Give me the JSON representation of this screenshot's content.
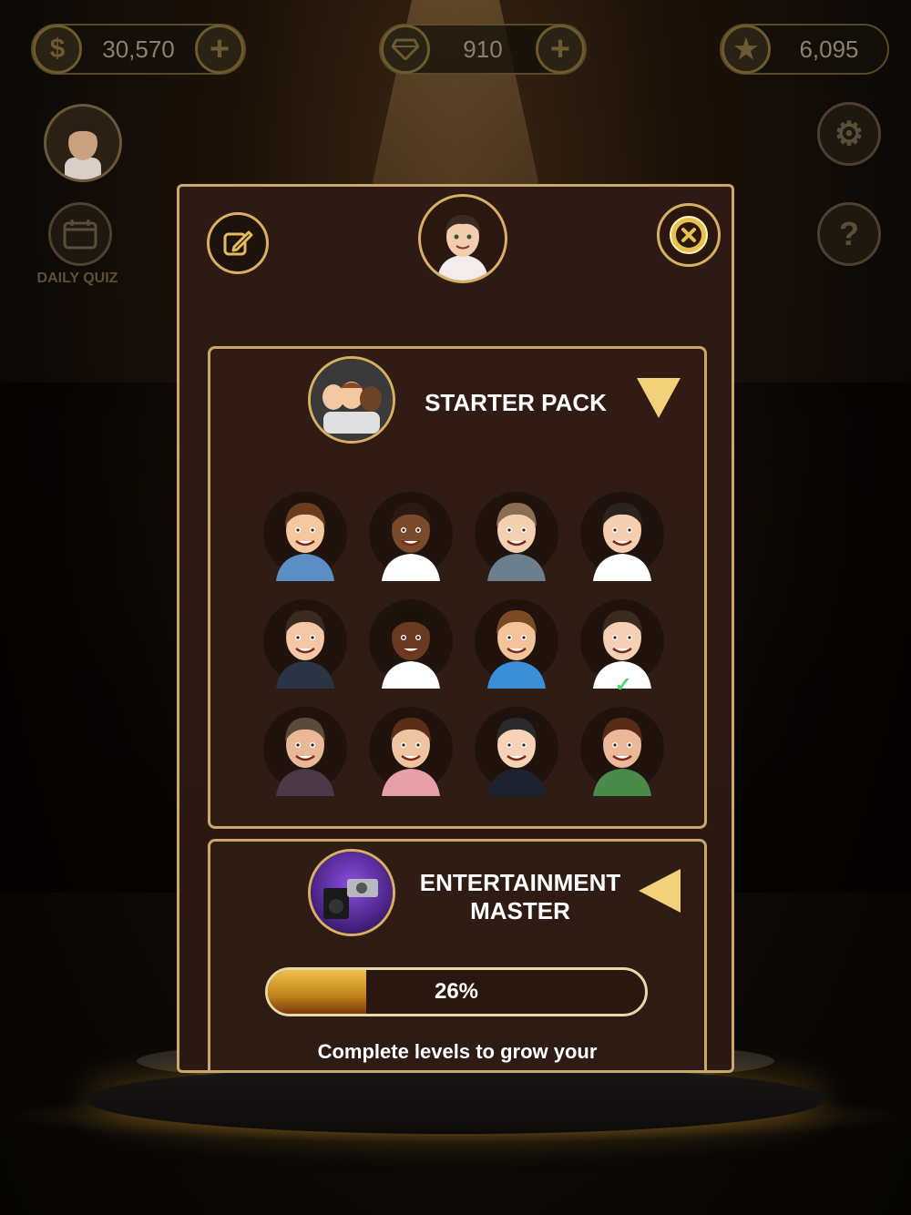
{
  "currency": {
    "coins": {
      "value": "30,570",
      "icon": "dollar-coin-icon"
    },
    "gems": {
      "value": "910",
      "icon": "diamond-icon"
    },
    "stars": {
      "value": "6,095",
      "icon": "star-icon"
    }
  },
  "side": {
    "daily_quiz_label": "DAILY QUIZ"
  },
  "modal": {
    "packs": [
      {
        "title": "STARTER PACK",
        "expanded": true,
        "avatars": [
          {
            "id": "a1",
            "skin": "#f6c8a0",
            "hair": "#6b3d1e",
            "shirt": "#5a8ec5",
            "selected": false
          },
          {
            "id": "a2",
            "skin": "#7a4a2a",
            "hair": "#2a1a10",
            "shirt": "#ffffff",
            "selected": false
          },
          {
            "id": "a3",
            "skin": "#f3d0b0",
            "hair": "#8a6f55",
            "shirt": "#6c7f8f",
            "selected": false
          },
          {
            "id": "a4",
            "skin": "#f6cfb0",
            "hair": "#2a2320",
            "shirt": "#ffffff",
            "selected": false
          },
          {
            "id": "a5",
            "skin": "#f4c8a6",
            "hair": "#3a2a20",
            "shirt": "#2a3444",
            "selected": false
          },
          {
            "id": "a6",
            "skin": "#6a3a20",
            "hair": "#1c120c",
            "shirt": "#ffffff",
            "selected": false
          },
          {
            "id": "a7",
            "skin": "#f3c39a",
            "hair": "#7a4a22",
            "shirt": "#3a8fd6",
            "selected": false
          },
          {
            "id": "a8",
            "skin": "#f6d0b4",
            "hair": "#3a2a20",
            "shirt": "#ffffff",
            "selected": true
          },
          {
            "id": "a9",
            "skin": "#eab896",
            "hair": "#5a4a3a",
            "shirt": "#4a3a48",
            "selected": false
          },
          {
            "id": "a10",
            "skin": "#f0c4a0",
            "hair": "#5a2e1a",
            "shirt": "#e8a0a8",
            "selected": false
          },
          {
            "id": "a11",
            "skin": "#f6d2b8",
            "hair": "#2a2a2a",
            "shirt": "#1c2230",
            "selected": false
          },
          {
            "id": "a12",
            "skin": "#ecb89a",
            "hair": "#5a2a18",
            "shirt": "#4a8a4a",
            "selected": false
          }
        ]
      },
      {
        "title_line1": "ENTERTAINMENT",
        "title_line2": "MASTER",
        "expanded": false,
        "progress": 26,
        "progress_label": "26%",
        "description": "Complete levels to grow your"
      }
    ]
  },
  "colors": {
    "gold": "#d7b061",
    "panel": "#2c1913",
    "check": "#3fdc6a"
  }
}
